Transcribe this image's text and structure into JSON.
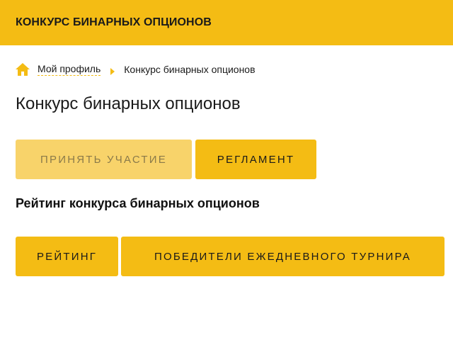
{
  "header": {
    "title": "КОНКУРС БИНАРНЫХ ОПЦИОНОВ"
  },
  "breadcrumb": {
    "home_icon": "home-icon",
    "items": [
      {
        "label": "Мой профиль"
      },
      {
        "label": "Конкурс бинарных опционов"
      }
    ]
  },
  "page": {
    "title": "Конкурс бинарных опционов"
  },
  "actions": {
    "participate_label": "ПРИНЯТЬ УЧАСТИЕ",
    "rules_label": "РЕГЛАМЕНТ"
  },
  "rating": {
    "title": "Рейтинг конкурса бинарных опционов",
    "rating_label": "РЕЙТИНГ",
    "winners_label": "ПОБЕДИТЕЛИ ЕЖЕДНЕВНОГО ТУРНИРА"
  },
  "colors": {
    "accent": "#f4bc14",
    "accent_disabled": "#f8d36a",
    "text": "#1a1a1a"
  }
}
